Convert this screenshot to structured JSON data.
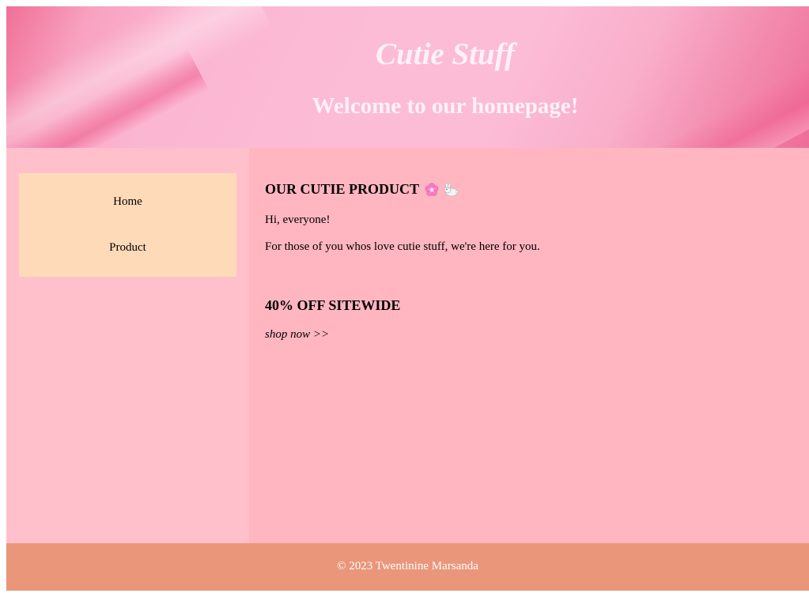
{
  "header": {
    "title": "Cutie Stuff",
    "subtitle": "Welcome to our homepage!"
  },
  "nav": {
    "items": [
      {
        "label": "Home"
      },
      {
        "label": "Product"
      }
    ]
  },
  "main": {
    "product_heading": "OUR CUTIE PRODUCT",
    "greeting": "Hi, everyone!",
    "intro": "For those of you whos love cutie stuff, we're here for you.",
    "sale_heading": "40% OFF SITEWIDE",
    "shop_link": "shop now >>",
    "icons": [
      "flower-icon",
      "bunny-icon"
    ]
  },
  "footer": {
    "copyright": "© 2023 Twentinine Marsanda"
  },
  "colors": {
    "sidebar": "#ffc0cb",
    "nav_box": "#ffdab9",
    "main": "#ffb6c1",
    "footer": "#e9967a",
    "header_text": "#fdf1f6"
  }
}
